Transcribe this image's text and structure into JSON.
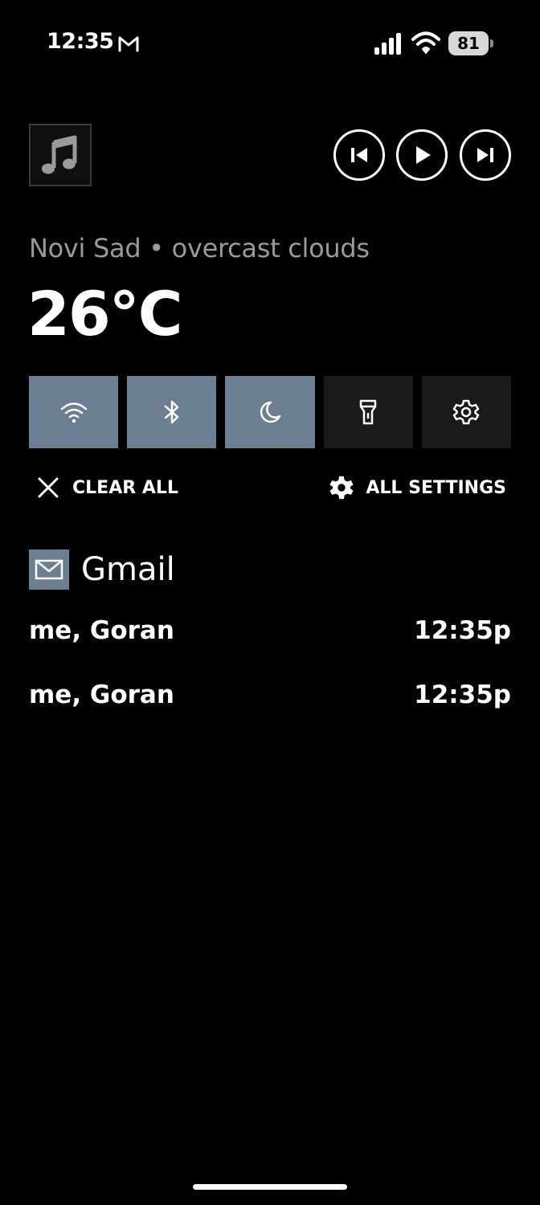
{
  "status_bar": {
    "time": "12:35",
    "battery_level": "81"
  },
  "media": {
    "icons": [
      "music-note-icon",
      "skip-previous-icon",
      "play-icon",
      "skip-next-icon"
    ]
  },
  "weather": {
    "location_conditions": "Novi Sad • overcast clouds",
    "temperature": "26°C"
  },
  "quick_toggles": [
    {
      "name": "wifi",
      "icon": "wifi-icon",
      "state": "on"
    },
    {
      "name": "bluetooth",
      "icon": "bluetooth-icon",
      "state": "on"
    },
    {
      "name": "do-not-disturb",
      "icon": "moon-icon",
      "state": "on"
    },
    {
      "name": "flashlight",
      "icon": "flashlight-icon",
      "state": "off"
    },
    {
      "name": "settings",
      "icon": "gear-icon",
      "state": "off"
    }
  ],
  "actions": {
    "clear_all": "CLEAR ALL",
    "all_settings": "ALL SETTINGS"
  },
  "notifications": {
    "app_name": "Gmail",
    "items": [
      {
        "sender": "me, Goran",
        "time": "12:35p"
      },
      {
        "sender": "me, Goran",
        "time": "12:35p"
      }
    ]
  },
  "colors": {
    "background": "#000000",
    "toggle_on": "#6c7e92",
    "toggle_off": "#1a1a1a",
    "secondary_text": "#9a9a9a"
  }
}
